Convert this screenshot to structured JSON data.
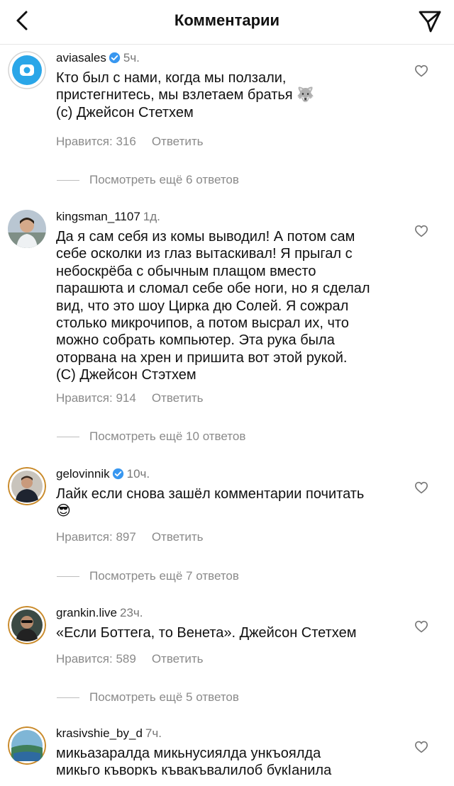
{
  "header": {
    "title": "Комментарии"
  },
  "icons": {
    "back": "chevron-left-icon",
    "send": "paper-plane-icon",
    "like": "heart-outline-icon",
    "verified": "verified-badge-icon"
  },
  "colors": {
    "verified_blue": "#3897f0",
    "secondary_text": "#8a8a8a"
  },
  "comments": [
    {
      "username": "aviasales",
      "verified": true,
      "time": "5ч.",
      "text": "Кто был с нами, когда мы ползали,\nпристегнитесь, мы взлетаем братья 🐺\n(c) Джейсон Стетхем",
      "likes_label": "Нравится: 316",
      "reply_label": "Ответить",
      "more_replies": "Посмотреть ещё 6 ответов"
    },
    {
      "username": "kingsman_1107",
      "verified": false,
      "time": "1д.",
      "text": "Да я сам себя из комы выводил! А потом сам\nсебе осколки из глаз вытаскивал! Я прыгал с\nнебоскрёба с обычным плащом вместо\nпарашюта и сломал себе обе ноги, но я сделал\nвид, что это шоу Цирка дю Солей. Я сожрал\nстолько микрочипов, а потом высрал их, что\nможно собрать компьютер. Эта рука была\nоторвана на хрен и пришита вот этой рукой.\n(С) Джейсон Стэтхем",
      "likes_label": "Нравится: 914",
      "reply_label": "Ответить",
      "more_replies": "Посмотреть ещё 10 ответов"
    },
    {
      "username": "gelovinnik",
      "verified": true,
      "time": "10ч.",
      "text": "Лайк если снова зашёл комментарии почитать\n😎",
      "likes_label": "Нравится: 897",
      "reply_label": "Ответить",
      "more_replies": "Посмотреть ещё 7 ответов"
    },
    {
      "username": "grankin.live",
      "verified": false,
      "time": "23ч.",
      "text": "«Если Боттега, то Венета». Джейсон Стетхем",
      "likes_label": "Нравится: 589",
      "reply_label": "Ответить",
      "more_replies": "Посмотреть ещё 5 ответов"
    },
    {
      "username": "krasivshie_by_d",
      "verified": false,
      "time": "7ч.",
      "text": "микьазаралда микьнусиялда ункъоялда\nмикьго къворкъ къвакъвалилоб букIанила",
      "likes_label": "",
      "reply_label": "",
      "more_replies": ""
    }
  ]
}
